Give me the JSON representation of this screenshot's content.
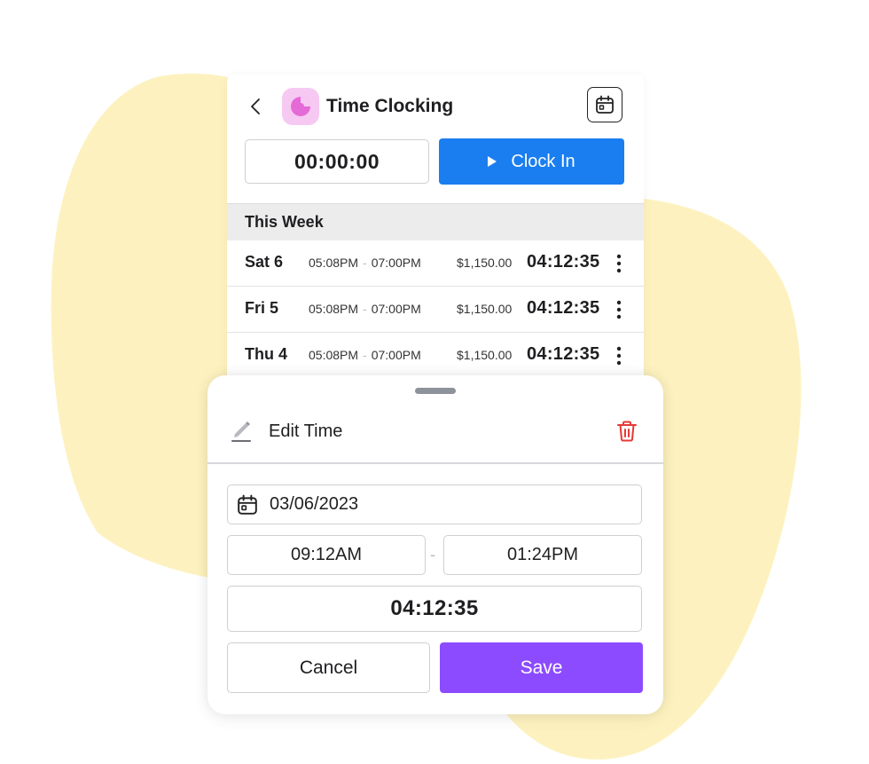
{
  "header": {
    "title": "Time Clocking",
    "back_icon": "chevron-left-icon",
    "app_icon": "app-logo-icon",
    "calendar_icon": "calendar-icon"
  },
  "timer": {
    "display": "00:00:00",
    "clock_in_label": "Clock In",
    "clock_in_icon": "play-icon"
  },
  "week": {
    "header": "This Week",
    "entries": [
      {
        "day": "Sat 6",
        "start": "05:08PM",
        "end": "07:00PM",
        "amount": "$1,150.00",
        "duration": "04:12:35"
      },
      {
        "day": "Fri 5",
        "start": "05:08PM",
        "end": "07:00PM",
        "amount": "$1,150.00",
        "duration": "04:12:35"
      },
      {
        "day": "Thu 4",
        "start": "05:08PM",
        "end": "07:00PM",
        "amount": "$1,150.00",
        "duration": "04:12:35"
      }
    ]
  },
  "edit_sheet": {
    "title": "Edit Time",
    "date": "03/06/2023",
    "start_time": "09:12AM",
    "end_time": "01:24PM",
    "duration": "04:12:35",
    "cancel_label": "Cancel",
    "save_label": "Save"
  },
  "colors": {
    "accent_blue": "#1a7ef0",
    "accent_purple": "#8c4bff",
    "delete_red": "#e53935",
    "blob_yellow": "#fdf2bf",
    "app_icon_bg": "#f6c9f2"
  }
}
